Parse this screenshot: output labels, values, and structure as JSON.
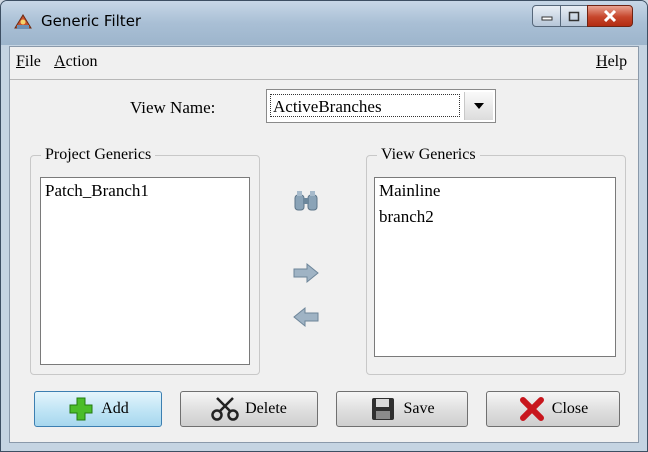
{
  "window": {
    "title": "Generic Filter"
  },
  "menu": {
    "file": "File",
    "file_accel": "F",
    "file_rest": "ile",
    "action": "Action",
    "action_accel": "A",
    "action_rest": "ction",
    "help": "Help",
    "help_accel": "H",
    "help_rest": "elp"
  },
  "view_name": {
    "label": "View Name:",
    "value": "ActiveBranches"
  },
  "project_generics": {
    "title": "Project Generics",
    "items": [
      "Patch_Branch1"
    ]
  },
  "view_generics": {
    "title": "View Generics",
    "items": [
      "Mainline",
      "branch2"
    ]
  },
  "buttons": {
    "add": "Add",
    "delete": "Delete",
    "save": "Save",
    "close": "Close"
  }
}
